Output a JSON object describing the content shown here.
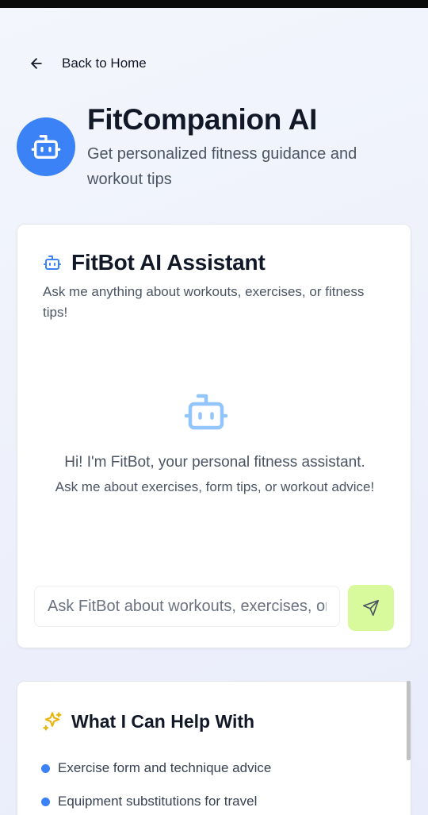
{
  "nav": {
    "back_label": "Back to Home"
  },
  "header": {
    "title": "FitCompanion AI",
    "subtitle": "Get personalized fitness guidance and workout tips",
    "avatar_icon": "bot-icon"
  },
  "chat": {
    "title": "FitBot AI Assistant",
    "description": "Ask me anything about workouts, exercises, or fitness tips!",
    "empty_greeting": "Hi! I'm FitBot, your personal fitness assistant.",
    "empty_hint": "Ask me about exercises, form tips, or workout advice!",
    "input_placeholder": "Ask FitBot about workouts, exercises, or fitness tips...",
    "input_value": "",
    "send_icon": "send-icon"
  },
  "help": {
    "title": "What I Can Help With",
    "icon": "sparkles-icon",
    "items": [
      {
        "label": "Exercise form and technique advice"
      },
      {
        "label": "Equipment substitutions for travel"
      }
    ]
  },
  "colors": {
    "primary": "#3b82f6",
    "send_button": "#d9f99d",
    "sparkle": "#eab308",
    "text_dark": "#111827",
    "text_muted": "#4b5563"
  }
}
